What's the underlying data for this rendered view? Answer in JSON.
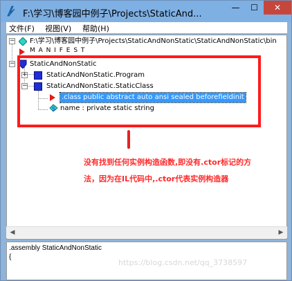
{
  "window": {
    "title": "F:\\学习\\博客园中例子\\Projects\\StaticAnd...",
    "min_symbol": "—",
    "max_symbol": "☐",
    "close_symbol": "✕"
  },
  "menu": {
    "file": "文件(F)",
    "view": "视图(V)",
    "help": "帮助(H)"
  },
  "tree": {
    "root": "F:\\学习\\博客园中例子\\Projects\\StaticAndNonStatic\\StaticAndNonStatic\\bin",
    "manifest": "M A N I F E S T",
    "namespace": "StaticAndNonStatic",
    "program": "StaticAndNonStatic.Program",
    "static_class": "StaticAndNonStatic.StaticClass",
    "class_directive": ".class public abstract auto ansi sealed beforefieldinit",
    "name_field": "name : private static string"
  },
  "annotation": {
    "text": "没有找到任何实例构造函数,即没有.ctor标记的方法，因为在IL代码中,.ctor代表实例构造器"
  },
  "code": {
    "line1": ".assembly StaticAndNonStatic",
    "line2": "{"
  },
  "watermark": "https://blog.csdn.net/qq_3738597",
  "colors": {
    "accent": "#ff1a1a",
    "selection": "#3399ff",
    "node_blue": "#1f2fd6"
  }
}
